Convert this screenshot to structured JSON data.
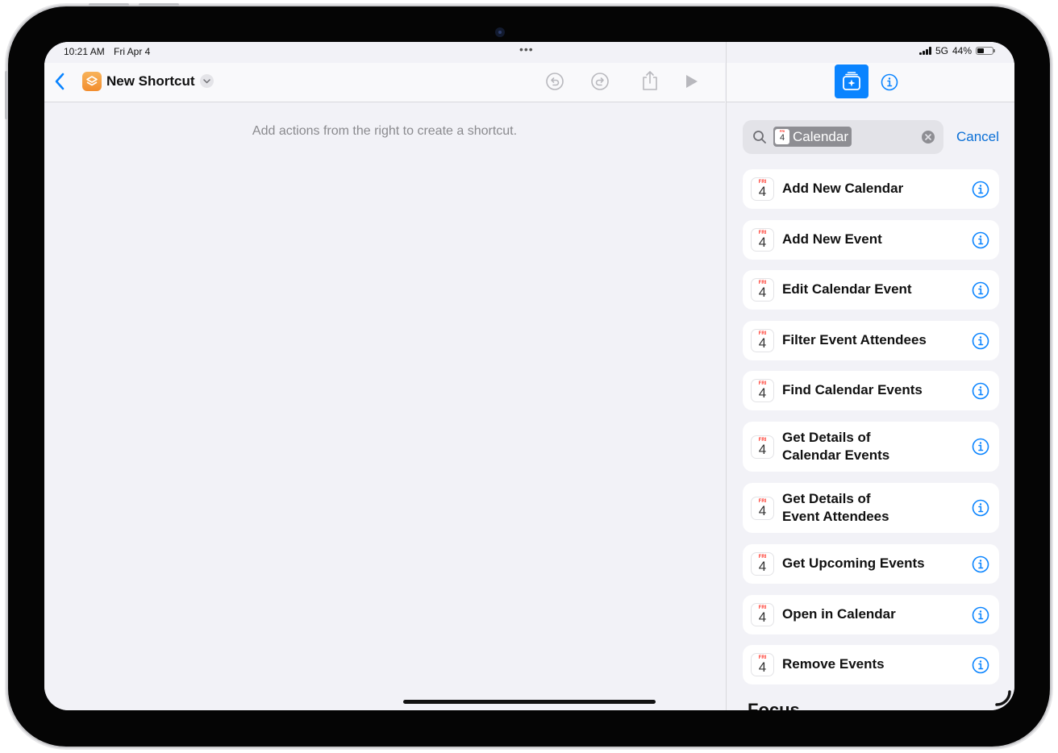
{
  "status_bar": {
    "time": "10:21 AM",
    "date": "Fri Apr 4",
    "network": "5G",
    "battery_percent": "44%",
    "battery_level": 0.44
  },
  "editor": {
    "title": "New Shortcut",
    "empty_hint": "Add actions from the right to create a shortcut."
  },
  "search": {
    "token_day": "4",
    "token_label": "Calendar",
    "cancel_label": "Cancel"
  },
  "calendar_icon": {
    "day_of_week": "FRI",
    "day": "4"
  },
  "actions": [
    {
      "label": "Add New Calendar"
    },
    {
      "label": "Add New Event"
    },
    {
      "label": "Edit Calendar Event"
    },
    {
      "label": "Filter Event Attendees"
    },
    {
      "label": "Find Calendar Events"
    },
    {
      "label": "Get Details of Calendar Events"
    },
    {
      "label": "Get Details of Event Attendees"
    },
    {
      "label": "Get Upcoming Events"
    },
    {
      "label": "Open in Calendar"
    },
    {
      "label": "Remove Events"
    }
  ],
  "next_section": "Focus",
  "colors": {
    "accent": "#0a84ff",
    "link": "#0a6fd6",
    "app_icon": "#f28d2e",
    "calendar_red": "#ff3b30"
  }
}
